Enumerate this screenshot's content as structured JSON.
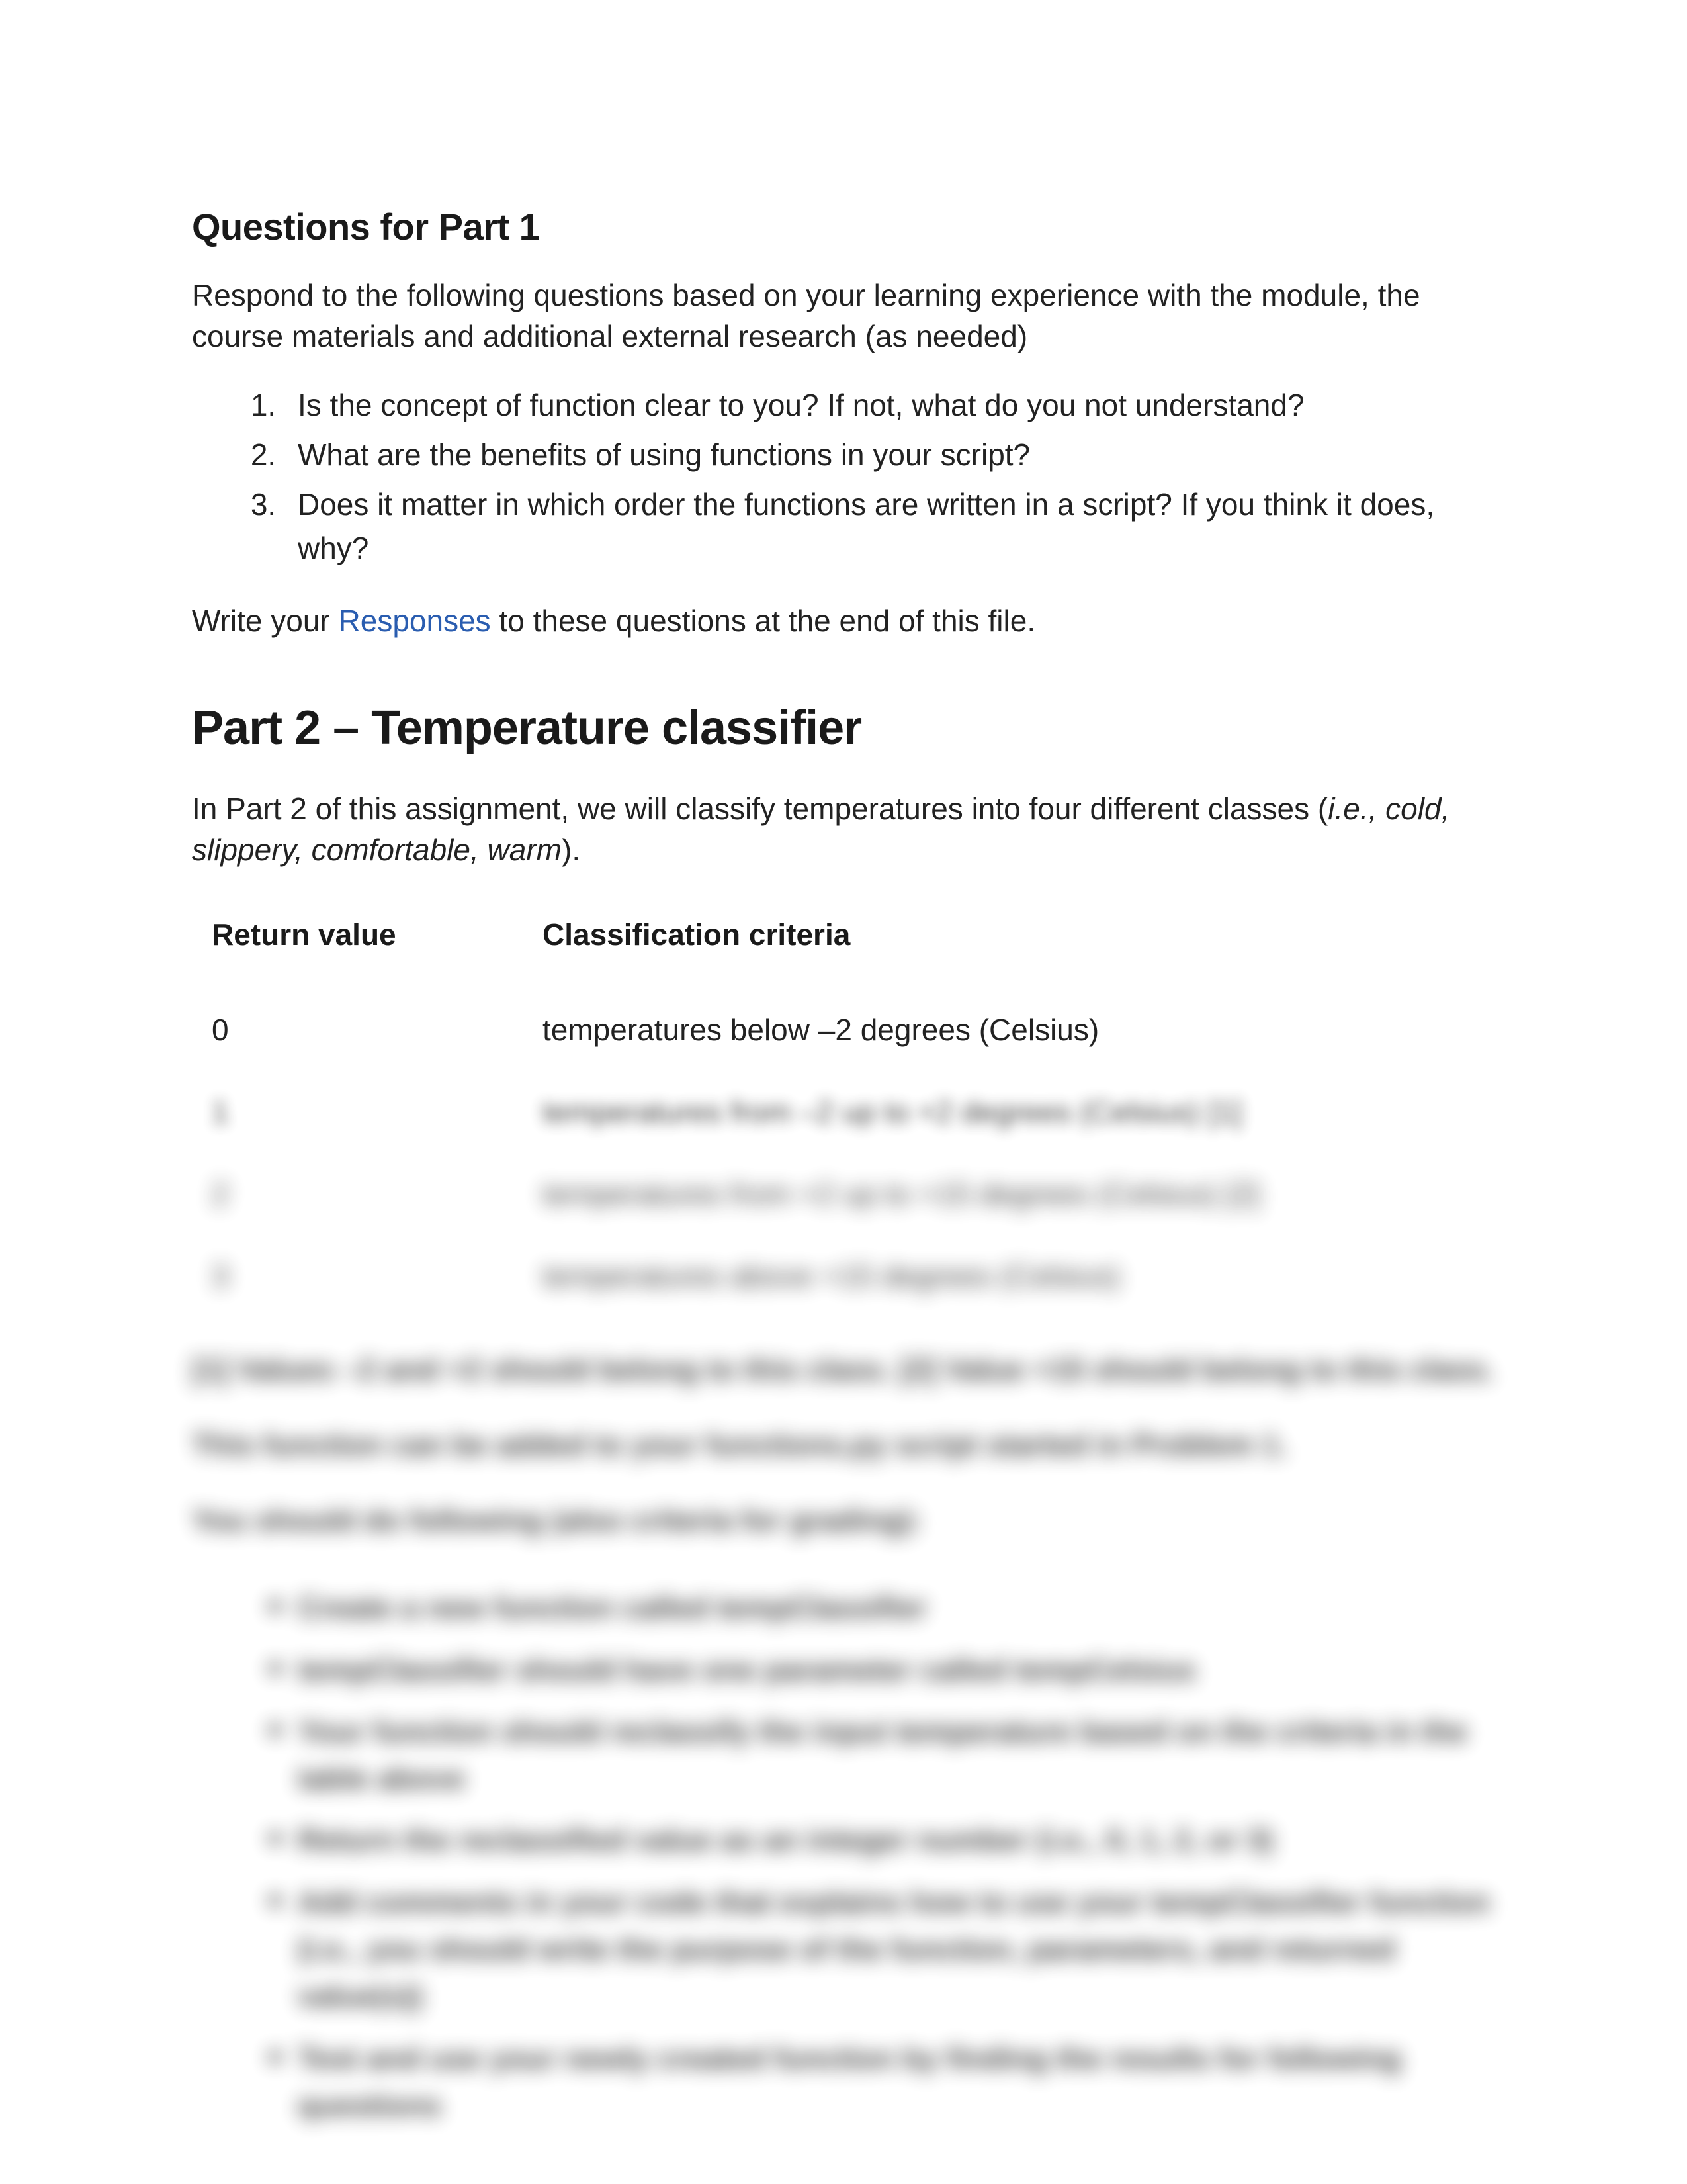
{
  "section1": {
    "heading": "Questions for Part 1",
    "intro": "Respond to the following questions based on your learning experience with the module, the course materials and additional external research (as needed)",
    "questions": [
      "Is the concept of function clear to you? If not, what do you not understand?",
      "What are the benefits of using functions in your script?",
      "Does it matter in which order the functions are written in a script? If you think it does, why?"
    ],
    "write_pre": "Write your ",
    "write_link": "Responses",
    "write_post": " to these questions at the end of this file."
  },
  "section2": {
    "heading": "Part 2 – Temperature classifier",
    "intro_a": "In Part 2 of this assignment, we will classify temperatures into four different classes (",
    "intro_i": "i.e., cold, slippery, comfortable, warm",
    "intro_b": ").",
    "table": {
      "head_rv": "Return value",
      "head_cc": "Classification criteria",
      "rows": [
        {
          "rv": "0",
          "cc": "temperatures below –2 degrees (Celsius)"
        },
        {
          "rv": "1",
          "cc": "temperatures from –2 up to +2 degrees (Celsius) [1]"
        },
        {
          "rv": "2",
          "cc": "temperatures from +2 up to +15 degrees (Celsius) [2]"
        },
        {
          "rv": "3",
          "cc": "temperatures above +15 degrees (Celsius)"
        }
      ]
    },
    "blurred_paras": [
      "[1] Values –2 and +2 should belong to this class. [2] Value +15 should belong to this class.",
      "This function can be added to your functions.py script started in Problem 1.",
      "You should do following (also criteria for grading):"
    ],
    "blurred_bullets": [
      "Create a new function called tempClassifier",
      "tempClassifier should have one parameter called tempCelsius",
      "Your function should reclassify the input temperature based on the criteria in the table above",
      "Return the reclassified value as an integer number (i.e., 0, 1, 2, or 3)",
      "Add comments in your code that explains how to use your tempClassifier function (i.e., you should write the purpose of the function, parameters, and returned value(s))",
      "Test and use your newly created function by finding the results for following questions"
    ]
  }
}
